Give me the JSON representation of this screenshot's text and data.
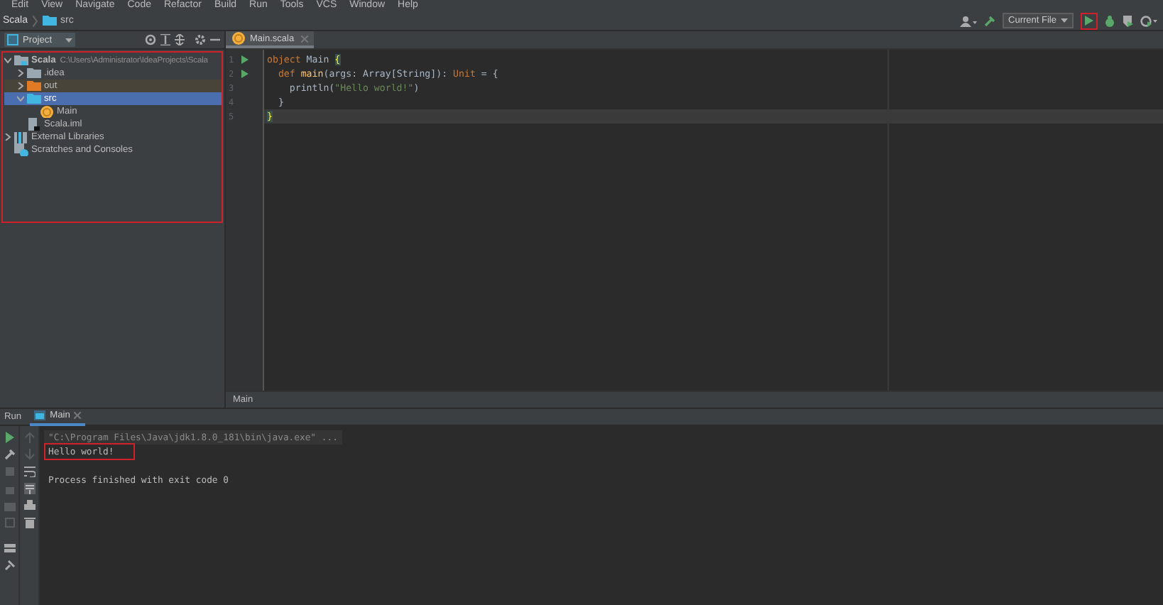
{
  "menu_bar": {
    "items": [
      "Edit",
      "View",
      "Navigate",
      "Code",
      "Refactor",
      "Build",
      "Run",
      "Tools",
      "VCS",
      "Window",
      "Help"
    ]
  },
  "breadcrumbs": [
    "Scala",
    "src"
  ],
  "toolbar": {
    "run_config": "Current File",
    "run_highlighted": true
  },
  "project_panel": {
    "title": "Project",
    "highlighted": true,
    "tree": [
      {
        "label": "Scala",
        "detail": "C:\\Users\\Administrator\\IdeaProjects\\Scala",
        "kind": "module",
        "expanded": true,
        "selected": false,
        "children": [
          {
            "label": ".idea",
            "kind": "folder",
            "expanded": false,
            "selected": false
          },
          {
            "label": "out",
            "kind": "excluded-folder",
            "expanded": false,
            "selected": false
          },
          {
            "label": "src",
            "kind": "source-folder",
            "expanded": true,
            "selected": true,
            "children": [
              {
                "label": "Main",
                "kind": "scala-object",
                "selected": false
              }
            ]
          },
          {
            "label": "Scala.iml",
            "kind": "iml",
            "selected": false
          }
        ]
      },
      {
        "label": "External Libraries",
        "kind": "library",
        "expanded": false,
        "selected": false
      },
      {
        "label": "Scratches and Consoles",
        "kind": "scratches",
        "selected": false
      }
    ]
  },
  "editor": {
    "tab": "Main.scala",
    "breadcrumb": "Main",
    "lines": [
      {
        "number": "1",
        "runnable": true,
        "current": false,
        "tokens": [
          {
            "kind": "keyword",
            "text": "object"
          },
          {
            "kind": "plain",
            "text": " Main "
          },
          {
            "kind": "brace",
            "text": "{"
          }
        ]
      },
      {
        "number": "2",
        "runnable": true,
        "current": false,
        "tokens": [
          {
            "kind": "keyword",
            "text": "  def"
          },
          {
            "kind": "method",
            "text": " main"
          },
          {
            "kind": "plain",
            "text": "(args: Array[String]): "
          },
          {
            "kind": "keyword",
            "text": "Unit"
          },
          {
            "kind": "plain",
            "text": " = {"
          }
        ]
      },
      {
        "number": "3",
        "runnable": false,
        "current": false,
        "tokens": [
          {
            "kind": "plain",
            "text": "    println("
          },
          {
            "kind": "string",
            "text": "\"Hello world!\""
          },
          {
            "kind": "plain",
            "text": ")"
          }
        ]
      },
      {
        "number": "4",
        "runnable": false,
        "current": false,
        "tokens": [
          {
            "kind": "plain",
            "text": "  }"
          }
        ]
      },
      {
        "number": "5",
        "runnable": false,
        "current": true,
        "tokens": [
          {
            "kind": "brace",
            "text": "}"
          }
        ]
      }
    ]
  },
  "run_panel": {
    "title": "Run",
    "tab": "Main",
    "console": [
      {
        "kind": "command",
        "text": "\"C:\\Program Files\\Java\\jdk1.8.0_181\\bin\\java.exe\" ...",
        "highlighted": false
      },
      {
        "kind": "output",
        "text": "Hello world!",
        "highlighted": true
      },
      {
        "kind": "status",
        "text": "Process finished with exit code 0",
        "highlighted": false
      }
    ]
  }
}
